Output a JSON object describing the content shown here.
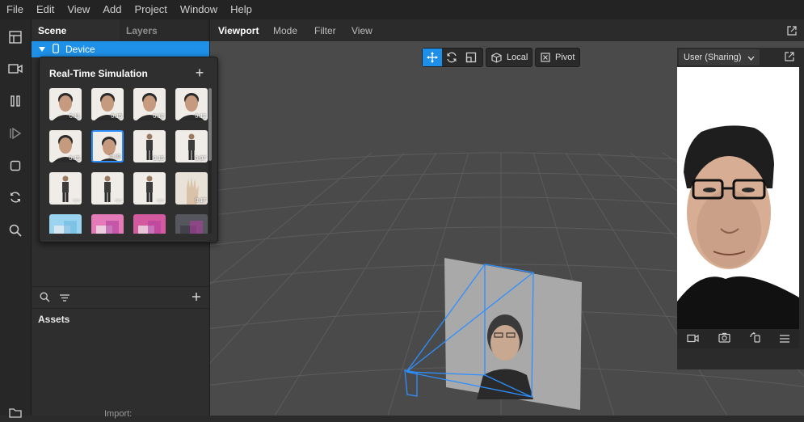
{
  "menu": [
    "File",
    "Edit",
    "View",
    "Add",
    "Project",
    "Window",
    "Help"
  ],
  "left_panel": {
    "tabs": [
      "Scene",
      "Layers"
    ],
    "device_label": "Device",
    "assets_title": "Assets",
    "import_label": "Import:"
  },
  "popup": {
    "title": "Real-Time Simulation",
    "add_label": "+",
    "thumbnails": [
      {
        "duration": "0:11",
        "kind": "face"
      },
      {
        "duration": "0:15",
        "kind": "face"
      },
      {
        "duration": "0:12",
        "kind": "face"
      },
      {
        "duration": "0:12",
        "kind": "face"
      },
      {
        "duration": "0:15",
        "kind": "face"
      },
      {
        "duration": "0:10",
        "kind": "face",
        "selected": true
      },
      {
        "duration": "0:15",
        "kind": "body"
      },
      {
        "duration": "0:07",
        "kind": "body"
      },
      {
        "duration": "-:--",
        "kind": "body"
      },
      {
        "duration": "-:--",
        "kind": "body"
      },
      {
        "duration": "-:--",
        "kind": "body"
      },
      {
        "duration": "0:17",
        "kind": "hand"
      },
      {
        "duration": "",
        "kind": "scene"
      },
      {
        "duration": "",
        "kind": "scene"
      },
      {
        "duration": "",
        "kind": "scene"
      },
      {
        "duration": "",
        "kind": "scene"
      }
    ]
  },
  "viewport": {
    "tabs": [
      "Viewport",
      "Mode",
      "Filter",
      "View"
    ],
    "local_label": "Local",
    "pivot_label": "Pivot",
    "preview_select": "User (Sharing)"
  },
  "colors": {
    "accent": "#1e90e8",
    "grid": "#5a5a5a",
    "camera": "#2d8fff"
  }
}
